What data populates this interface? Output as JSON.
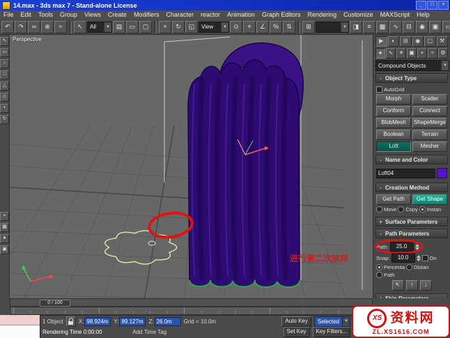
{
  "window": {
    "title": "14.max - 3ds max 7 - Stand-alone License",
    "minimize": "_",
    "maximize": "□",
    "close": "×"
  },
  "menu": {
    "items": [
      "File",
      "Edit",
      "Tools",
      "Group",
      "Views",
      "Create",
      "Modifiers",
      "Character",
      "reactor",
      "Animation",
      "Graph Editors",
      "Rendering",
      "Customize",
      "MAXScript",
      "Help"
    ]
  },
  "toolbar": {
    "selection_filter": "All",
    "ref_coord": "View",
    "groups": {
      "g1": [
        {
          "name": "undo-icon",
          "glyph": "↶"
        },
        {
          "name": "redo-icon",
          "glyph": "↷"
        },
        {
          "name": "select-and-link-icon",
          "glyph": "∞"
        },
        {
          "name": "unlink-selection-icon",
          "glyph": "⊗"
        },
        {
          "name": "bind-to-spacewarp-icon",
          "glyph": "≈"
        }
      ],
      "g2": [
        {
          "name": "select-object-icon",
          "glyph": "↖"
        }
      ],
      "g3": [
        {
          "name": "select-by-name-icon",
          "glyph": "▤"
        },
        {
          "name": "selection-region-icon",
          "glyph": "▭"
        },
        {
          "name": "window-crossing-icon",
          "glyph": "▢"
        }
      ],
      "g4": [
        {
          "name": "select-and-move-icon",
          "glyph": "+"
        },
        {
          "name": "select-and-rotate-icon",
          "glyph": "↻"
        },
        {
          "name": "select-and-scale-icon",
          "glyph": "◱"
        }
      ],
      "g5": [
        {
          "name": "use-center-icon",
          "glyph": "⊙"
        },
        {
          "name": "snap-toggle-icon",
          "glyph": "⌖"
        },
        {
          "name": "angle-snap-icon",
          "glyph": "∠"
        },
        {
          "name": "percent-snap-icon",
          "glyph": "%"
        },
        {
          "name": "spinner-snap-icon",
          "glyph": "⇅"
        }
      ],
      "g6": [
        {
          "name": "edit-named-selections-icon",
          "glyph": "⊞"
        }
      ],
      "g7": [
        {
          "name": "mirror-icon",
          "glyph": "◨"
        },
        {
          "name": "align-icon",
          "glyph": "≡"
        },
        {
          "name": "layer-manager-icon",
          "glyph": "▩"
        },
        {
          "name": "curve-editor-icon",
          "glyph": "∿"
        },
        {
          "name": "schematic-view-icon",
          "glyph": "⊟"
        },
        {
          "name": "material-editor-icon",
          "glyph": "◉"
        },
        {
          "name": "render-scene-icon",
          "glyph": "▣"
        },
        {
          "name": "render-type-icon",
          "glyph": "▭"
        },
        {
          "name": "quick-render-icon",
          "glyph": "●"
        }
      ]
    }
  },
  "left_toolbar": {
    "top": [
      {
        "name": "select-tool-icon",
        "glyph": "↖"
      },
      {
        "name": "region-tool-icon",
        "glyph": "▭"
      },
      {
        "name": "circle-tool-icon",
        "glyph": "○"
      },
      {
        "name": "square-tool-icon",
        "glyph": "□"
      },
      {
        "name": "triangle-tool-icon",
        "glyph": "△"
      },
      {
        "name": "diamond-tool-icon",
        "glyph": "◇"
      },
      {
        "name": "add-tool-icon",
        "glyph": "+"
      },
      {
        "name": "rotate-tool-icon",
        "glyph": "↻"
      }
    ],
    "bottom": [
      {
        "name": "target-tool-icon",
        "glyph": "⌖"
      },
      {
        "name": "grid-tool-icon",
        "glyph": "▦"
      },
      {
        "name": "dot-tool-icon",
        "glyph": "●"
      },
      {
        "name": "box-tool-icon",
        "glyph": "▣"
      }
    ]
  },
  "viewport": {
    "label": "Perspective",
    "annotation": "进行第二次放样"
  },
  "command_panel": {
    "tabs_row1": [
      {
        "name": "tab-create-icon",
        "glyph": "▶",
        "active": true
      },
      {
        "name": "tab-modify-icon",
        "glyph": "◐"
      },
      {
        "name": "tab-hierarchy-icon",
        "glyph": "⊟"
      },
      {
        "name": "tab-motion-icon",
        "glyph": "◉"
      },
      {
        "name": "tab-display-icon",
        "glyph": "▢"
      },
      {
        "name": "tab-utilities-icon",
        "glyph": "⚒"
      }
    ],
    "tabs_row2": [
      {
        "name": "subtab-geometry-icon",
        "glyph": "●",
        "active": true
      },
      {
        "name": "subtab-shapes-icon",
        "glyph": "∿"
      },
      {
        "name": "subtab-lights-icon",
        "glyph": "☀"
      },
      {
        "name": "subtab-cameras-icon",
        "glyph": "▣"
      },
      {
        "name": "subtab-helpers-icon",
        "glyph": "+"
      },
      {
        "name": "subtab-spacewarps-icon",
        "glyph": "≈"
      },
      {
        "name": "subtab-systems-icon",
        "glyph": "⚙"
      }
    ],
    "category_dropdown": "Compound Objects",
    "object_type": {
      "sign": "-",
      "title": "Object Type",
      "autogrid_label": "AutoGrid",
      "buttons": [
        {
          "label": "Morph"
        },
        {
          "label": "Scatter"
        },
        {
          "label": "Conform"
        },
        {
          "label": "Connect"
        },
        {
          "label": "BlobMesh"
        },
        {
          "label": "ShapeMerge"
        },
        {
          "label": "Boolean"
        },
        {
          "label": "Terrain"
        },
        {
          "label": "Loft",
          "active": true
        },
        {
          "label": "Mesher"
        }
      ]
    },
    "name_color": {
      "sign": "-",
      "title": "Name and Color",
      "name": "Loft04",
      "color": "#5a14c8"
    },
    "creation_method": {
      "sign": "-",
      "title": "Creation Method",
      "get_path": "Get Path",
      "get_shape": "Get Shape",
      "move_label": "Move",
      "copy_label": "Copy",
      "instance_label": "Instan"
    },
    "surface_parameters": {
      "sign": "+",
      "title": "Surface Parameters"
    },
    "path_parameters": {
      "sign": "-",
      "title": "Path Parameters",
      "path_label": "Path:",
      "path_value": "25.0",
      "snap_label": "Snap:",
      "snap_value": "10.0",
      "on_label": "On",
      "percentage_label": "Percenta",
      "distance_label": "Distan",
      "path_steps_label": "Path",
      "pick_buttons": [
        {
          "name": "pick-shape-icon",
          "glyph": "↖"
        },
        {
          "name": "previous-shape-icon",
          "glyph": "↑"
        },
        {
          "name": "next-shape-icon",
          "glyph": "↓"
        }
      ]
    },
    "skin_parameters": {
      "sign": "+",
      "title": "Skin Parameters"
    }
  },
  "timeline": {
    "slider_label": "0 / 100"
  },
  "status": {
    "object_count": "1 Object",
    "x_label": "X:",
    "x_value": "98.924m",
    "y_label": "Y:",
    "y_value": "89.127m",
    "z_label": "Z:",
    "z_value": "26.0m",
    "grid_label": "Grid = 10.0m",
    "auto_key": "Auto Key",
    "selected_mode": "Selected",
    "set_key": "Set Key",
    "key_filters": "Key Filters...",
    "add_time_tag": "Add Time Tag",
    "prompt": "Rendering Time  0:00:00"
  },
  "watermark": {
    "logo_text": "XS",
    "name": "资料网",
    "url": "ZL.XS1616.COM"
  },
  "colors": {
    "object": "#2e0b72",
    "object_light": "#3a1287",
    "rib": "#1a0550",
    "highlight": "#6a35c8",
    "outline": "#160340",
    "spline": "#e6e6a2",
    "green_edge": "#2fae4e",
    "grid": "#5a5a5a",
    "grid_dark": "#454545",
    "wire": "#e2e2e2",
    "annotation": "#d81414"
  }
}
